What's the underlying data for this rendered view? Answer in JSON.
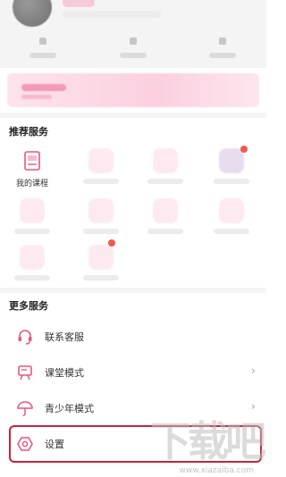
{
  "sections": {
    "recommended_title": "推荐服务",
    "more_title": "更多服务"
  },
  "recommended": {
    "first_item_label": "我的课程"
  },
  "more_services": [
    {
      "label": "联系客服",
      "icon": "headset-icon"
    },
    {
      "label": "课堂模式",
      "icon": "whiteboard-icon"
    },
    {
      "label": "青少年模式",
      "icon": "umbrella-icon"
    },
    {
      "label": "设置",
      "icon": "gear-icon"
    }
  ],
  "watermark": {
    "text": "下载吧",
    "url": "www.xiazaiba.com"
  },
  "colors": {
    "accent": "#e8577e",
    "highlight_border": "#c8233d",
    "badge": "#f05a4b"
  }
}
